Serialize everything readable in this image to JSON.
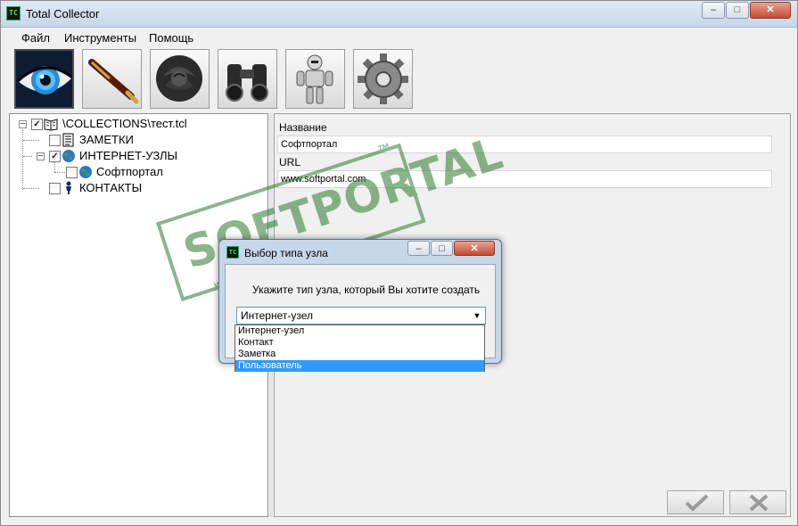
{
  "window": {
    "title": "Total Collector",
    "app_icon_text": "TC",
    "controls": {
      "minimize": "–",
      "maximize": "□",
      "close": "✕"
    }
  },
  "menu": {
    "items": [
      "Файл",
      "Инструменты",
      "Помощь"
    ]
  },
  "toolbar": {
    "items": [
      {
        "icon": "eye-icon",
        "selected": true
      },
      {
        "icon": "pen-icon"
      },
      {
        "icon": "rose-icon"
      },
      {
        "icon": "binoculars-icon"
      },
      {
        "icon": "robot-icon"
      },
      {
        "icon": "gear-icon"
      }
    ]
  },
  "tree": {
    "root": {
      "label": "\\COLLECTIONS\\тест.tcl",
      "checked": "✓",
      "expander": "–"
    },
    "notes": {
      "label": "ЗАМЕТКИ",
      "checked": ""
    },
    "internet": {
      "label": "ИНТЕРНЕТ-УЗЛЫ",
      "checked": "✓",
      "expander": "–"
    },
    "softportal": {
      "label": "Софтпортал",
      "checked": ""
    },
    "contacts": {
      "label": "КОНТАКТЫ",
      "checked": ""
    }
  },
  "details": {
    "name_label": "Название",
    "name_value": "Софтпортал",
    "url_label": "URL",
    "url_value": "www.softportal.com",
    "ok_icon": "check-icon",
    "cancel_icon": "cross-icon"
  },
  "watermark": {
    "text": "SOFTPORTAL",
    "tm": "™",
    "url": "www.softportal.com"
  },
  "dialog": {
    "title": "Выбор типа узла",
    "prompt": "Укажите тип узла, который Вы хотите создать",
    "selected": "Интернет-узел",
    "arrow": "▼",
    "options": [
      "Интернет-узел",
      "Контакт",
      "Заметка",
      "Пользователь"
    ],
    "highlighted_index": 3
  },
  "colors": {
    "selection": "#3399ff",
    "watermark": "#2d7a2d"
  }
}
